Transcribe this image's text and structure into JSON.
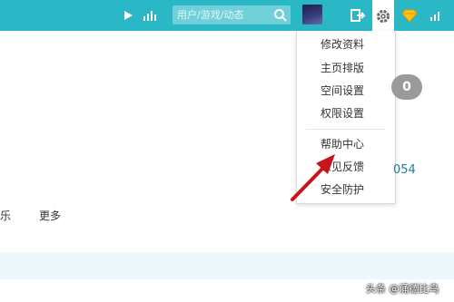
{
  "topbar": {
    "icons": [
      "play-icon",
      "bars-icon",
      "search-icon",
      "avatar",
      "logout-icon",
      "gear-icon",
      "gem-icon",
      "signal-icon"
    ],
    "search": {
      "placeholder": "用户/游戏/动态"
    }
  },
  "settings_menu": {
    "items": [
      {
        "label": "修改资料"
      },
      {
        "label": "主页排版"
      },
      {
        "label": "空间设置"
      },
      {
        "label": "权限设置"
      },
      {
        "label": "帮助中心"
      },
      {
        "label": "意见反馈"
      },
      {
        "label": "安全防护"
      }
    ]
  },
  "badge": {
    "count": "0"
  },
  "side_number": "054",
  "nav": {
    "music_partial": "乐",
    "more": "更多"
  },
  "annotation": {
    "arrow_color": "#c8151b"
  },
  "watermark": "头条 @涌德比鸟",
  "colors": {
    "topbar": "#2ab7c6",
    "search_box": "#6fd0da",
    "badge": "#9a9a9a",
    "link": "#1a7f9a"
  }
}
